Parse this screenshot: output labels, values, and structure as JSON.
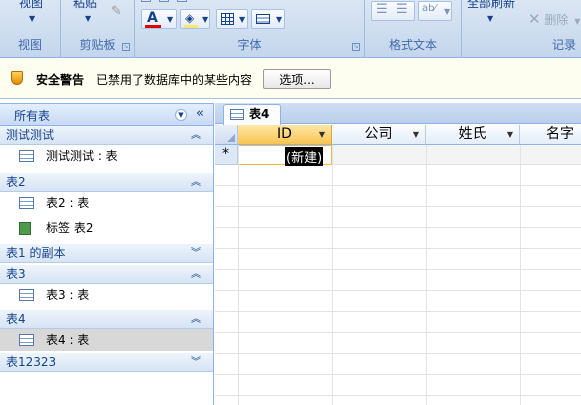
{
  "ribbon": {
    "groups": [
      {
        "name": "视图",
        "button": "视图"
      },
      {
        "name": "剪贴板",
        "button": "粘贴"
      },
      {
        "name": "字体"
      },
      {
        "name": "格式文本"
      },
      {
        "name": "记录",
        "button": "全部刷新",
        "delete_label": "删除"
      }
    ]
  },
  "security": {
    "title": "安全警告",
    "message": "已禁用了数据库中的某些内容",
    "options_button": "选项..."
  },
  "nav": {
    "title": "所有表",
    "groups": [
      {
        "name": "测试测试",
        "items": [
          {
            "label": "测试测试 : 表",
            "icon": "table-icon"
          }
        ]
      },
      {
        "name": "表2",
        "items": [
          {
            "label": "表2 : 表",
            "icon": "table-icon"
          },
          {
            "label": "标签 表2",
            "icon": "form-icon"
          }
        ]
      },
      {
        "name": "表1 的副本",
        "items": []
      },
      {
        "name": "表3",
        "items": [
          {
            "label": "表3 : 表",
            "icon": "table-icon"
          }
        ]
      },
      {
        "name": "表4",
        "items": [
          {
            "label": "表4 : 表",
            "icon": "table-icon",
            "selected": true
          }
        ]
      },
      {
        "name": "表12323",
        "items": []
      }
    ]
  },
  "document": {
    "tab": "表4",
    "columns": [
      "ID",
      "公司",
      "姓氏",
      "名字"
    ],
    "new_row": {
      "marker": "*",
      "value": "(新建)"
    }
  },
  "colors": {
    "accent": "#15428b",
    "ribbon_bg": "#c4d6ec",
    "selection": "#d8d8d8",
    "new_row_cell": "#000000"
  }
}
